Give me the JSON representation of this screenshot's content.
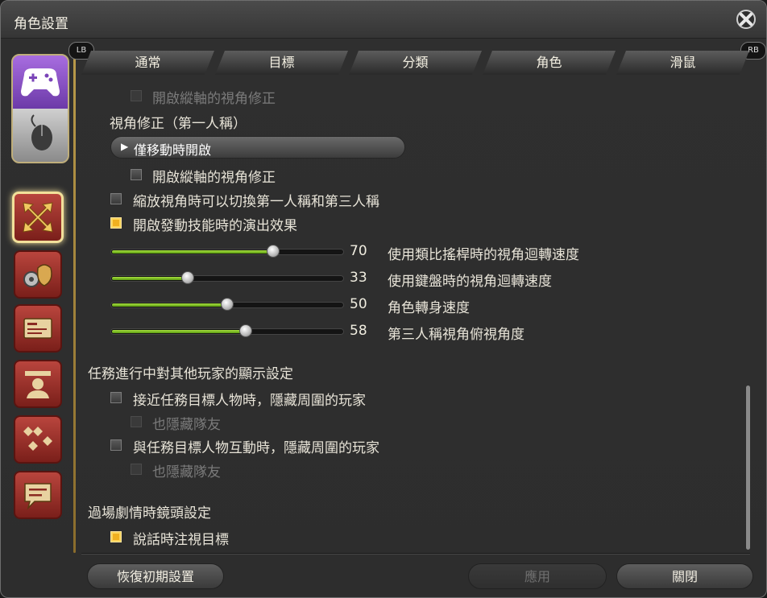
{
  "window": {
    "title": "角色設置"
  },
  "tabs": [
    {
      "label": "通常",
      "active": true
    },
    {
      "label": "目標"
    },
    {
      "label": "分類"
    },
    {
      "label": "角色"
    },
    {
      "label": "滑鼠"
    }
  ],
  "badges": {
    "left": "LB",
    "right": "RB"
  },
  "content": {
    "row_top_partial": "開啟縱軸的視角修正",
    "first_person_heading": "視角修正（第一人稱）",
    "dropdown_value": "僅移動時開啟",
    "row_vertical": "開啟縱軸的視角修正",
    "row_zoom_switch": "縮放視角時可以切換第一人稱和第三人稱",
    "row_skill_effect": "開啟發動技能時的演出效果",
    "sliders": [
      {
        "value": 70,
        "percent": 70,
        "label": "使用類比搖桿時的視角迴轉速度"
      },
      {
        "value": 33,
        "percent": 33,
        "label": "使用鍵盤時的視角迴轉速度"
      },
      {
        "value": 50,
        "percent": 50,
        "label": "角色轉身速度"
      },
      {
        "value": 58,
        "percent": 58,
        "label": "第三人稱視角俯視角度"
      }
    ],
    "quest_heading": "任務進行中對其他玩家的顯示設定",
    "quest_hide_near": "接近任務目標人物時，隱藏周圍的玩家",
    "quest_hide_party_1": "也隱藏隊友",
    "quest_hide_interact": "與任務目標人物互動時，隱藏周圍的玩家",
    "quest_hide_party_2": "也隱藏隊友",
    "cutscene_heading": "過場劇情時鏡頭設定",
    "cutscene_look": "說話時注視目標"
  },
  "footer": {
    "reset": "恢復初期設置",
    "apply": "應用",
    "close": "關閉"
  },
  "colors": {
    "accent_gold": "#f0b020",
    "slider_green": "#8cc92a",
    "cat_red": "#9b2f28"
  }
}
